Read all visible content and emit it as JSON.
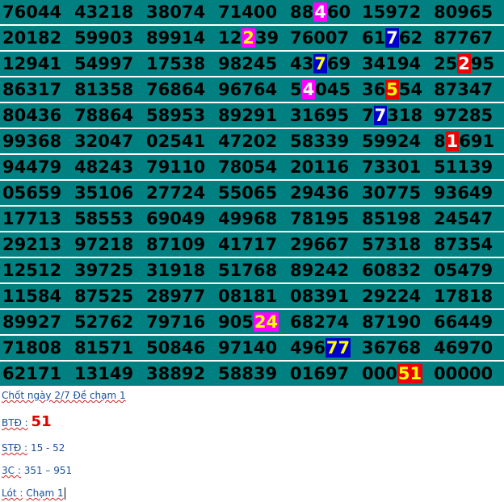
{
  "colors": {
    "row_background": "#008080",
    "text": "#000000",
    "note_text": "#1a4f9c",
    "accent_red": "#e00000"
  },
  "grid": [
    [
      "76044",
      "43218",
      "38074",
      "71400",
      "88460",
      "15972",
      "80965"
    ],
    [
      "20182",
      "59903",
      "89914",
      "12239",
      "76007",
      "61762",
      "87767"
    ],
    [
      "12941",
      "54997",
      "17538",
      "98245",
      "43769",
      "34194",
      "25295"
    ],
    [
      "86317",
      "81358",
      "76864",
      "96764",
      "54045",
      "36554",
      "87347"
    ],
    [
      "80436",
      "78864",
      "58953",
      "89291",
      "31695",
      "77318",
      "97285"
    ],
    [
      "99368",
      "32047",
      "02541",
      "47202",
      "58339",
      "59924",
      "81691"
    ],
    [
      "94479",
      "48243",
      "79110",
      "78054",
      "20116",
      "73301",
      "51139"
    ],
    [
      "05659",
      "35106",
      "27724",
      "55065",
      "29436",
      "30775",
      "93649"
    ],
    [
      "17713",
      "58553",
      "69049",
      "49968",
      "78195",
      "85198",
      "24547"
    ],
    [
      "29213",
      "97218",
      "87109",
      "41717",
      "29667",
      "57318",
      "87354"
    ],
    [
      "12512",
      "39725",
      "31918",
      "51768",
      "89242",
      "60832",
      "05479"
    ],
    [
      "11584",
      "87525",
      "28977",
      "08181",
      "08391",
      "29224",
      "17818"
    ],
    [
      "89927",
      "52762",
      "79716",
      "90524",
      "68274",
      "87190",
      "66449"
    ],
    [
      "71808",
      "81571",
      "50846",
      "97140",
      "49677",
      "36768",
      "46970"
    ],
    [
      "62171",
      "13149",
      "38892",
      "58839",
      "01697",
      "00051",
      "00000"
    ]
  ],
  "highlights": [
    {
      "row": 0,
      "col": 4,
      "start": 2,
      "len": 1,
      "bg": "#ff00ff",
      "fg": "#ffffff"
    },
    {
      "row": 1,
      "col": 3,
      "start": 2,
      "len": 1,
      "bg": "#ff00ff",
      "fg": "#ffff00"
    },
    {
      "row": 1,
      "col": 5,
      "start": 2,
      "len": 1,
      "bg": "#0000cc",
      "fg": "#ffffff"
    },
    {
      "row": 2,
      "col": 4,
      "start": 2,
      "len": 1,
      "bg": "#0000cc",
      "fg": "#ffff00"
    },
    {
      "row": 2,
      "col": 6,
      "start": 2,
      "len": 1,
      "bg": "#ee0000",
      "fg": "#ffffff"
    },
    {
      "row": 3,
      "col": 4,
      "start": 1,
      "len": 1,
      "bg": "#ff00ff",
      "fg": "#ffffff"
    },
    {
      "row": 3,
      "col": 5,
      "start": 2,
      "len": 1,
      "bg": "#ee0000",
      "fg": "#ffff00"
    },
    {
      "row": 4,
      "col": 5,
      "start": 1,
      "len": 1,
      "bg": "#0000cc",
      "fg": "#ffffff"
    },
    {
      "row": 5,
      "col": 6,
      "start": 1,
      "len": 1,
      "bg": "#ee0000",
      "fg": "#ffffff"
    },
    {
      "row": 12,
      "col": 3,
      "start": 3,
      "len": 2,
      "bg": "#ff00ff",
      "fg": "#ffff00"
    },
    {
      "row": 13,
      "col": 4,
      "start": 3,
      "len": 2,
      "bg": "#0000cc",
      "fg": "#ffff00"
    },
    {
      "row": 14,
      "col": 5,
      "start": 3,
      "len": 2,
      "bg": "#ee0000",
      "fg": "#ffff00"
    }
  ],
  "notes": {
    "line1": "Chốt ngày 2/7 Đề chạm 1",
    "btd_label": "BTĐ :",
    "btd_value": "51",
    "std_label": "STĐ :",
    "std_value": "15 - 52",
    "threec_label": "3C :",
    "threec_value": "351 – 951",
    "lot_label": "Lót :",
    "lot_value": "Chạm 1"
  }
}
